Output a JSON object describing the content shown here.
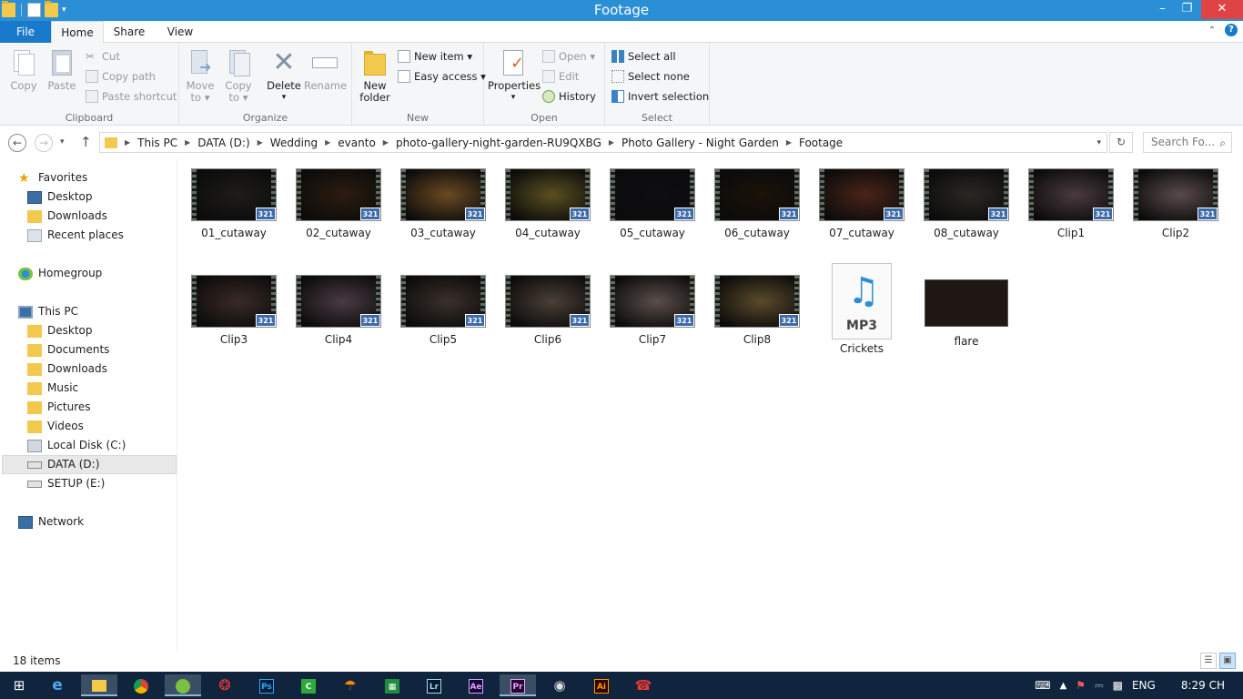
{
  "window": {
    "title": "Footage",
    "minimize": "–",
    "maximize": "❐",
    "close": "✕"
  },
  "tabs": {
    "file": "File",
    "home": "Home",
    "share": "Share",
    "view": "View"
  },
  "ribbon": {
    "clipboard": {
      "label": "Clipboard",
      "copy": "Copy",
      "paste": "Paste",
      "cut": "Cut",
      "copy_path": "Copy path",
      "paste_shortcut": "Paste shortcut"
    },
    "organize": {
      "label": "Organize",
      "move_to_1": "Move",
      "move_to_2": "to ▾",
      "copy_to_1": "Copy",
      "copy_to_2": "to ▾",
      "delete": "Delete",
      "delete_arrow": "▾",
      "rename": "Rename"
    },
    "new": {
      "label": "New",
      "new_folder_1": "New",
      "new_folder_2": "folder",
      "new_item": "New item ▾",
      "easy_access": "Easy access ▾"
    },
    "open": {
      "label": "Open",
      "properties": "Properties",
      "properties_arrow": "▾",
      "open": "Open ▾",
      "edit": "Edit",
      "history": "History"
    },
    "select": {
      "label": "Select",
      "select_all": "Select all",
      "select_none": "Select none",
      "invert_selection": "Invert selection"
    }
  },
  "address": {
    "back": "←",
    "forward": "→",
    "recent": "▾",
    "up": "↑",
    "crumbs": [
      "This PC",
      "DATA (D:)",
      "Wedding",
      "evanto",
      "photo-gallery-night-garden-RU9QXBG",
      "Photo Gallery - Night Garden",
      "Footage"
    ],
    "dropdown": "▾",
    "refresh": "↻",
    "search_placeholder": "Search Fo...",
    "search_icon": "⌕"
  },
  "nav": {
    "favorites": "Favorites",
    "desktop": "Desktop",
    "downloads": "Downloads",
    "recent_places": "Recent places",
    "homegroup": "Homegroup",
    "this_pc": "This PC",
    "pc_desktop": "Desktop",
    "documents": "Documents",
    "pc_downloads": "Downloads",
    "music": "Music",
    "pictures": "Pictures",
    "videos": "Videos",
    "local_disk": "Local Disk (C:)",
    "data_d": "DATA (D:)",
    "setup_e": "SETUP (E:)",
    "network": "Network"
  },
  "files": [
    {
      "name": "01_cutaway",
      "type": "video",
      "color": "#1d1c1a"
    },
    {
      "name": "02_cutaway",
      "type": "video",
      "color": "#2b1c10"
    },
    {
      "name": "03_cutaway",
      "type": "video",
      "color": "#6a4a22"
    },
    {
      "name": "04_cutaway",
      "type": "video",
      "color": "#5a5020"
    },
    {
      "name": "05_cutaway",
      "type": "video",
      "color": "#0e0e12"
    },
    {
      "name": "06_cutaway",
      "type": "video",
      "color": "#1a1208"
    },
    {
      "name": "07_cutaway",
      "type": "video",
      "color": "#4a2418"
    },
    {
      "name": "08_cutaway",
      "type": "video",
      "color": "#2a2822"
    },
    {
      "name": "Clip1",
      "type": "video",
      "color": "#4a3a40"
    },
    {
      "name": "Clip2",
      "type": "video",
      "color": "#5a4a4a"
    },
    {
      "name": "Clip3",
      "type": "video",
      "color": "#3a2a26"
    },
    {
      "name": "Clip4",
      "type": "video",
      "color": "#4a3a42"
    },
    {
      "name": "Clip5",
      "type": "video",
      "color": "#3a302a"
    },
    {
      "name": "Clip6",
      "type": "video",
      "color": "#4a3e36"
    },
    {
      "name": "Clip7",
      "type": "video",
      "color": "#5a4e4a"
    },
    {
      "name": "Clip8",
      "type": "video",
      "color": "#5a4a2a"
    },
    {
      "name": "Crickets",
      "type": "mp3"
    },
    {
      "name": "flare",
      "type": "image"
    }
  ],
  "thumb_badge": "321",
  "mp3_label": "MP3",
  "mp3_icon": "♫",
  "status": {
    "count": "18 items"
  },
  "taskbar": {
    "ps": "Ps",
    "lr": "Lr",
    "ae": "Ae",
    "pr": "Pr",
    "ai": "Ai",
    "lang": "ENG",
    "time": "8:29 CH"
  }
}
